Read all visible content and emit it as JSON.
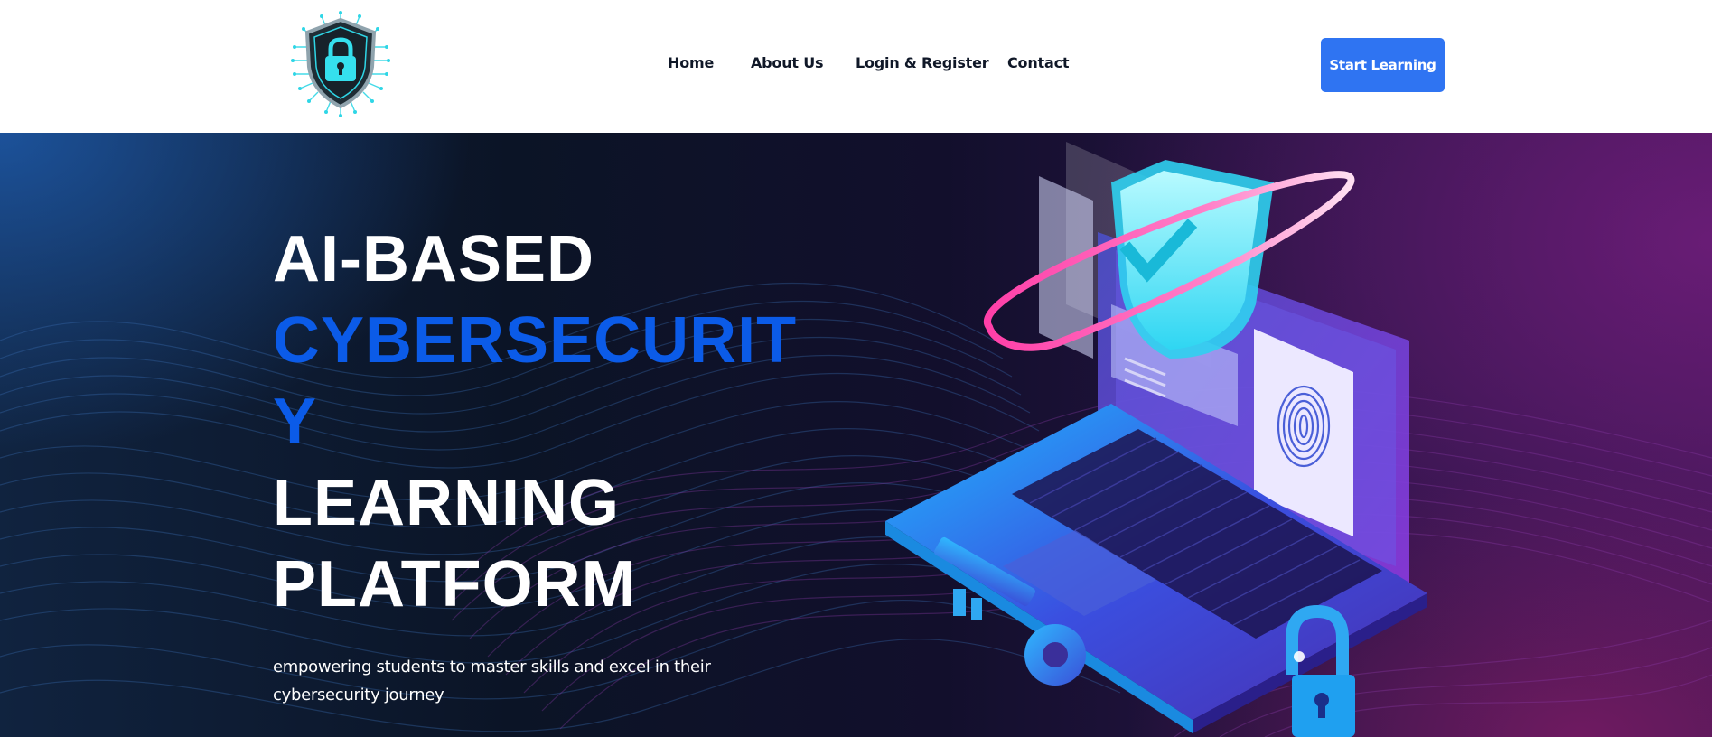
{
  "header": {
    "logo_name": "shield-lock-logo",
    "nav": [
      {
        "label": "Home"
      },
      {
        "label": "About Us"
      },
      {
        "label": "Login & Register"
      },
      {
        "label": "Contact"
      }
    ],
    "cta_label": "Start Learning"
  },
  "hero": {
    "title_lines": [
      "AI-BASED",
      "CYBERSECURIT",
      "Y",
      "LEARNING",
      "PLATFORM"
    ],
    "subtitle_lines": [
      "empowering students to master skills and excel in their",
      "cybersecurity journey"
    ],
    "illustration": "laptop-security-illustration"
  },
  "colors": {
    "accent_blue": "#2f74f2",
    "title_blue": "#0b5be8",
    "nav_text": "#101828"
  }
}
